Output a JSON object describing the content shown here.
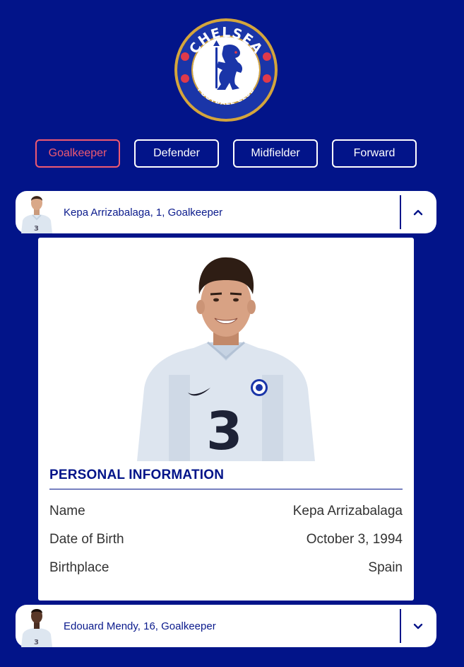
{
  "filters": {
    "items": [
      {
        "label": "Goalkeeper",
        "active": true
      },
      {
        "label": "Defender",
        "active": false
      },
      {
        "label": "Midfielder",
        "active": false
      },
      {
        "label": "Forward",
        "active": false
      }
    ]
  },
  "players": [
    {
      "title": "Kepa Arrizabalaga, 1, Goalkeeper",
      "expanded": true,
      "toggle_icon": "chevron-up-icon"
    },
    {
      "title": "Edouard Mendy, 16, Goalkeeper",
      "expanded": false,
      "toggle_icon": "chevron-down-icon"
    }
  ],
  "details": {
    "section_title": "PERSONAL INFORMATION",
    "rows": [
      {
        "label": "Name",
        "value": "Kepa Arrizabalaga"
      },
      {
        "label": "Date of Birth",
        "value": "October 3, 1994"
      },
      {
        "label": "Birthplace",
        "value": "Spain"
      }
    ]
  },
  "colors": {
    "background": "#021489",
    "accent_active": "#ef5a72",
    "text_dark": "#333333",
    "crest_gold": "#d4a53c"
  }
}
